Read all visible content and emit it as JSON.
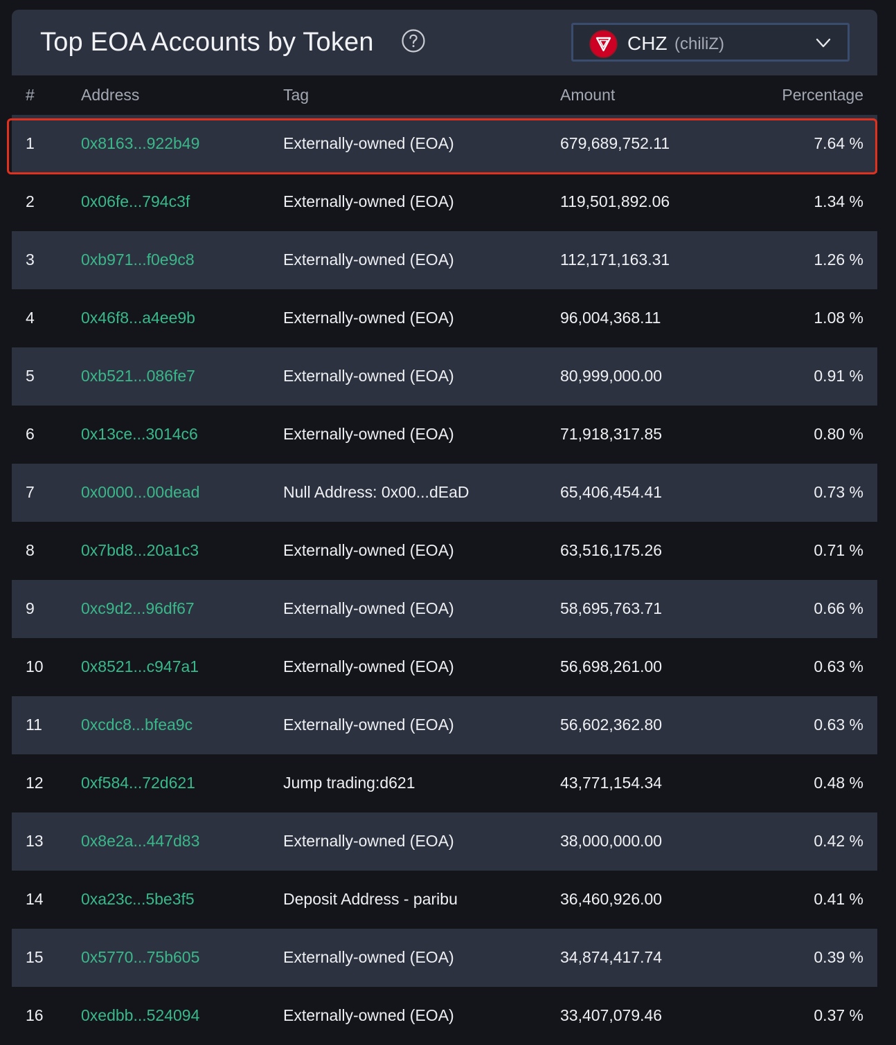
{
  "header": {
    "title": "Top EOA Accounts by Token",
    "help_icon": "question-circle-icon"
  },
  "token_select": {
    "symbol": "CHZ",
    "name": "(chiliZ)",
    "logo_icon": "chiliz-logo-icon",
    "chevron_icon": "chevron-down-icon",
    "logo_color": "#cd0124"
  },
  "colors": {
    "address_link": "#39b88a",
    "highlight_border": "#e0311f",
    "row_alt_bg": "#2d3240"
  },
  "table": {
    "columns": {
      "rank": "#",
      "address": "Address",
      "tag": "Tag",
      "amount": "Amount",
      "percentage": "Percentage"
    },
    "highlighted_rank": "1",
    "rows": [
      {
        "rank": "1",
        "address": "0x8163...922b49",
        "tag": "Externally-owned (EOA)",
        "amount": "679,689,752.11",
        "percentage": "7.64 %"
      },
      {
        "rank": "2",
        "address": "0x06fe...794c3f",
        "tag": "Externally-owned (EOA)",
        "amount": "119,501,892.06",
        "percentage": "1.34 %"
      },
      {
        "rank": "3",
        "address": "0xb971...f0e9c8",
        "tag": "Externally-owned (EOA)",
        "amount": "112,171,163.31",
        "percentage": "1.26 %"
      },
      {
        "rank": "4",
        "address": "0x46f8...a4ee9b",
        "tag": "Externally-owned (EOA)",
        "amount": "96,004,368.11",
        "percentage": "1.08 %"
      },
      {
        "rank": "5",
        "address": "0xb521...086fe7",
        "tag": "Externally-owned (EOA)",
        "amount": "80,999,000.00",
        "percentage": "0.91 %"
      },
      {
        "rank": "6",
        "address": "0x13ce...3014c6",
        "tag": "Externally-owned (EOA)",
        "amount": "71,918,317.85",
        "percentage": "0.80 %"
      },
      {
        "rank": "7",
        "address": "0x0000...00dead",
        "tag": "Null Address: 0x00...dEaD",
        "amount": "65,406,454.41",
        "percentage": "0.73 %"
      },
      {
        "rank": "8",
        "address": "0x7bd8...20a1c3",
        "tag": "Externally-owned (EOA)",
        "amount": "63,516,175.26",
        "percentage": "0.71 %"
      },
      {
        "rank": "9",
        "address": "0xc9d2...96df67",
        "tag": "Externally-owned (EOA)",
        "amount": "58,695,763.71",
        "percentage": "0.66 %"
      },
      {
        "rank": "10",
        "address": "0x8521...c947a1",
        "tag": "Externally-owned (EOA)",
        "amount": "56,698,261.00",
        "percentage": "0.63 %"
      },
      {
        "rank": "11",
        "address": "0xcdc8...bfea9c",
        "tag": "Externally-owned (EOA)",
        "amount": "56,602,362.80",
        "percentage": "0.63 %"
      },
      {
        "rank": "12",
        "address": "0xf584...72d621",
        "tag": "Jump trading:d621",
        "amount": "43,771,154.34",
        "percentage": "0.48 %"
      },
      {
        "rank": "13",
        "address": "0x8e2a...447d83",
        "tag": "Externally-owned (EOA)",
        "amount": "38,000,000.00",
        "percentage": "0.42 %"
      },
      {
        "rank": "14",
        "address": "0xa23c...5be3f5",
        "tag": "Deposit Address - paribu",
        "amount": "36,460,926.00",
        "percentage": "0.41 %"
      },
      {
        "rank": "15",
        "address": "0x5770...75b605",
        "tag": "Externally-owned (EOA)",
        "amount": "34,874,417.74",
        "percentage": "0.39 %"
      },
      {
        "rank": "16",
        "address": "0xedbb...524094",
        "tag": "Externally-owned (EOA)",
        "amount": "33,407,079.46",
        "percentage": "0.37 %"
      }
    ]
  }
}
